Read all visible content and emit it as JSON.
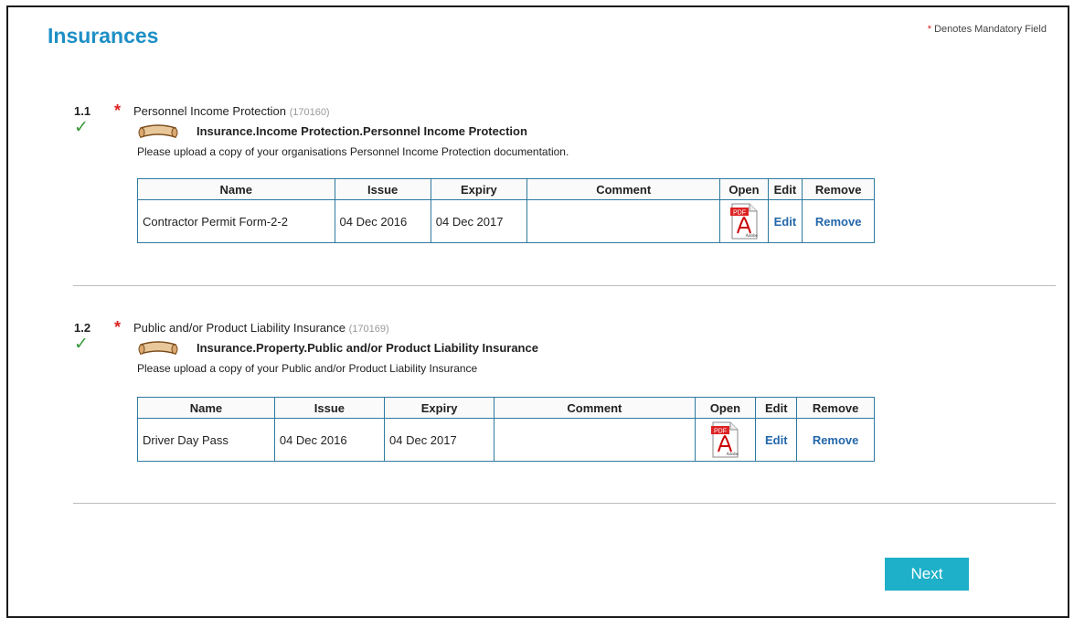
{
  "header": {
    "title": "Insurances",
    "mandatory_star": "*",
    "mandatory_note": "Denotes Mandatory Field"
  },
  "sections": [
    {
      "number": "1.1",
      "required_star": "*",
      "title": "Personnel Income Protection",
      "code": "(170160)",
      "doc_path": "Insurance.Income Protection.Personnel Income Protection",
      "instructions": "Please upload a copy of your organisations Personnel Income Protection documentation.",
      "table": {
        "headers": [
          "Name",
          "Issue",
          "Expiry",
          "Comment",
          "Open",
          "Edit",
          "Remove"
        ],
        "rows": [
          {
            "name": "Contractor Permit Form-2-2",
            "issue": "04 Dec 2016",
            "expiry": "04 Dec 2017",
            "comment": "",
            "edit": "Edit",
            "remove": "Remove"
          }
        ]
      }
    },
    {
      "number": "1.2",
      "required_star": "*",
      "title": "Public and/or Product Liability Insurance",
      "code": "(170169)",
      "doc_path": "Insurance.Property.Public and/or Product Liability Insurance",
      "instructions": "Please upload a copy of your Public and/or Product Liability Insurance",
      "table": {
        "headers": [
          "Name",
          "Issue",
          "Expiry",
          "Comment",
          "Open",
          "Edit",
          "Remove"
        ],
        "rows": [
          {
            "name": "Driver Day Pass",
            "issue": "04 Dec 2016",
            "expiry": "04 Dec 2017",
            "comment": "",
            "edit": "Edit",
            "remove": "Remove"
          }
        ]
      }
    }
  ],
  "footer": {
    "next_label": "Next"
  },
  "icons": {
    "check": "checkmark-icon",
    "document": "scroll-document-icon",
    "pdf": "pdf-file-icon"
  },
  "colors": {
    "title": "#1e8fc6",
    "required": "#dd2222",
    "check": "#3a9a3a",
    "table_border": "#2f7aa0",
    "link": "#2266aa",
    "next_button": "#1eb0c9"
  }
}
